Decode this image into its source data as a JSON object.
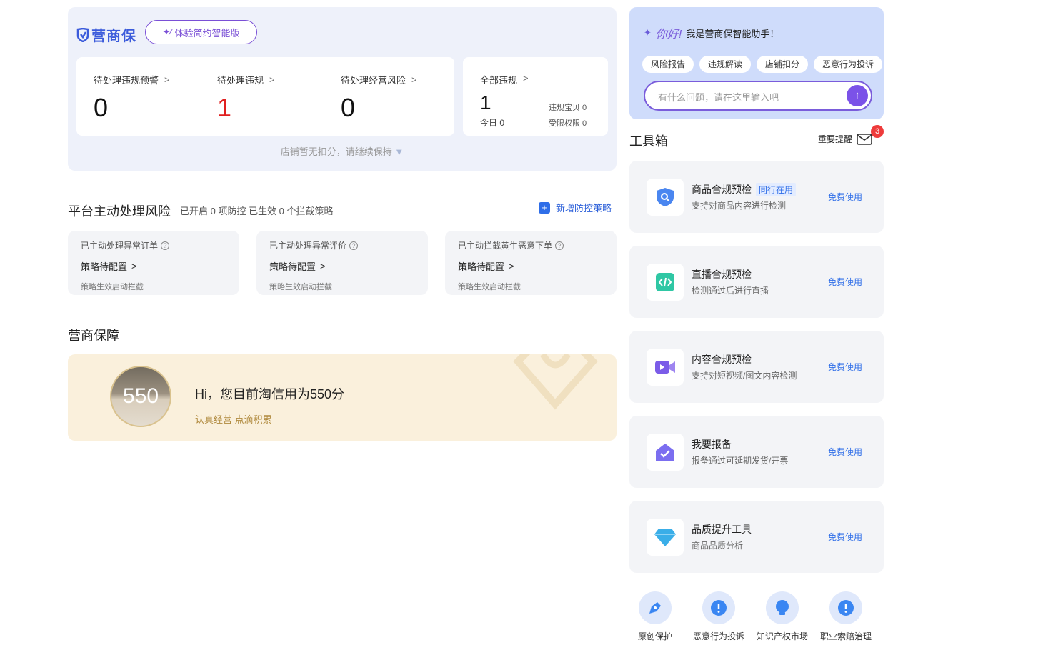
{
  "header": {
    "logo_text": "营商保",
    "experience_button": "体验简约智能版"
  },
  "stats": [
    {
      "label": "待处理违规预警",
      "value": "0"
    },
    {
      "label": "待处理违规",
      "value": "1"
    },
    {
      "label": "待处理经营风险",
      "value": "0"
    }
  ],
  "all_violations": {
    "label": "全部违规",
    "value": "1",
    "today": "今日 0",
    "items": "违规宝贝 0",
    "restrictions": "受限权限 0"
  },
  "deduction_note": "店铺暂无扣分，请继续保持",
  "platform_risk": {
    "title": "平台主动处理风险",
    "summary": "已开启 0 项防控 已生效 0 个拦截策略",
    "add_button": "新增防控策略",
    "cards": [
      {
        "title": "已主动处理异常订单",
        "status": "策略待配置",
        "note": "策略生效启动拦截"
      },
      {
        "title": "已主动处理异常评价",
        "status": "策略待配置",
        "note": "策略生效启动拦截"
      },
      {
        "title": "已主动拦截黄牛恶意下单",
        "status": "策略待配置",
        "note": "策略生效启动拦截"
      }
    ]
  },
  "guarantee": {
    "title": "营商保障",
    "score": "550",
    "greeting": "Hi，您目前淘信用为550分",
    "slogan": "认真经营 点滴积累"
  },
  "assistant": {
    "hello": "你好!",
    "intro": "我是营商保智能助手！",
    "chips": [
      "风险报告",
      "违规解读",
      "店铺扣分",
      "恶意行为投诉"
    ],
    "input_placeholder": "有什么问题，请在这里输入吧"
  },
  "toolbox": {
    "title": "工具箱",
    "notice": "重要提醒",
    "notice_count": "3",
    "tools": [
      {
        "name": "商品合规预检",
        "tag": "同行在用",
        "desc": "支持对商品内容进行检测",
        "action": "免费使用"
      },
      {
        "name": "直播合规预检",
        "tag": "",
        "desc": "检测通过后进行直播",
        "action": "免费使用"
      },
      {
        "name": "内容合规预检",
        "tag": "",
        "desc": "支持对短视频/图文内容检测",
        "action": "免费使用"
      },
      {
        "name": "我要报备",
        "tag": "",
        "desc": "报备通过可延期发货/开票",
        "action": "免费使用"
      },
      {
        "name": "品质提升工具",
        "tag": "",
        "desc": "商品品质分析",
        "action": "免费使用"
      }
    ],
    "bottom": [
      "原创保护",
      "恶意行为投诉",
      "知识产权市场",
      "职业索赔治理"
    ]
  },
  "colors": {
    "accent": "#2f6ee8",
    "danger": "#e02020",
    "purple": "#7a4fd6",
    "gold": "#b08a3e"
  }
}
